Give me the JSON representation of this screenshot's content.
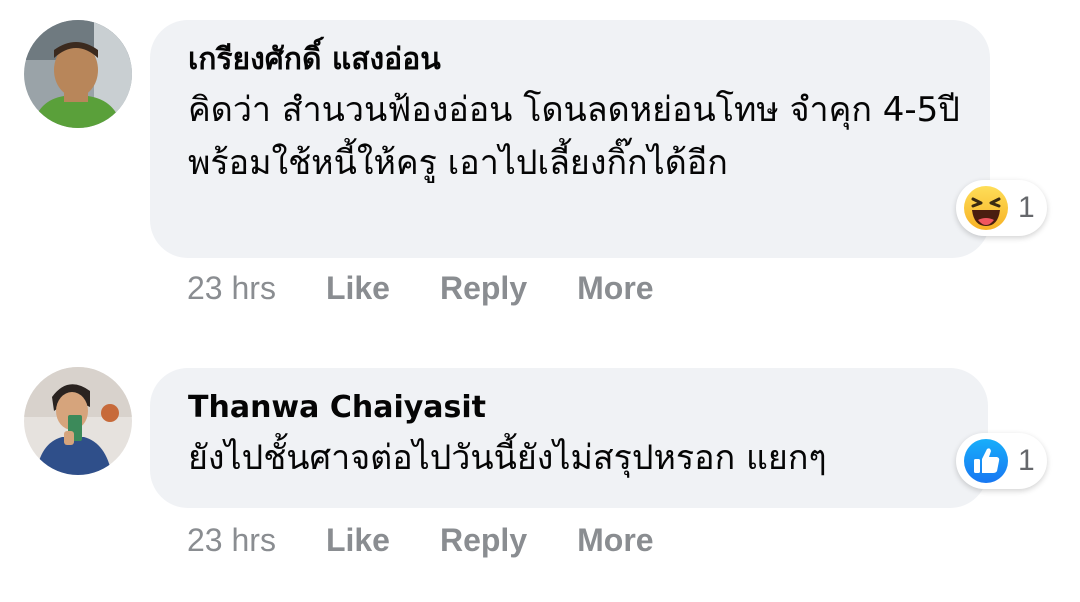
{
  "comments": [
    {
      "author": "เกรียงศักดิ์ แสงอ่อน",
      "text": "คิดว่า สำนวนฟ้องอ่อน โดนลดหย่อนโทษ จำคุก 4-5ปี พร้อมใช้หนี้ให้ครู เอาไปเลี้ยงกิ๊กได้อีก",
      "reaction": {
        "icon": "haha-icon",
        "count": "1"
      },
      "time": "23 hrs",
      "actions": {
        "like": "Like",
        "reply": "Reply",
        "more": "More"
      }
    },
    {
      "author": "Thanwa Chaiyasit",
      "text": "ยังไปชั้นศาจต่อไปวันนี้ยังไม่สรุปหรอก แยกๆ",
      "reaction": {
        "icon": "like-icon",
        "count": "1"
      },
      "time": "23 hrs",
      "actions": {
        "like": "Like",
        "reply": "Reply",
        "more": "More"
      }
    }
  ],
  "colors": {
    "bubble": "#f0f2f5",
    "text": "#050505",
    "meta": "#8a8d91",
    "like_blue": "#1877f2",
    "haha_yellow": "#f7b125"
  }
}
